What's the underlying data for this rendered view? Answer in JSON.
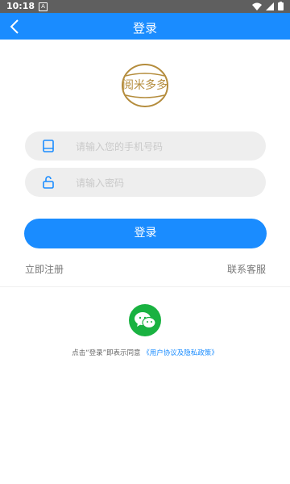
{
  "status": {
    "time": "10:18",
    "app_icon": "A"
  },
  "header": {
    "title": "登录"
  },
  "logo": {
    "text": "阅米多多"
  },
  "form": {
    "phone_placeholder": "请输入您的手机号码",
    "password_placeholder": "请输入密码",
    "login_label": "登录"
  },
  "links": {
    "register": "立即注册",
    "contact": "联系客服"
  },
  "agreement": {
    "prefix": "点击“登录”即表示同意",
    "policy": "《用户协议及隐私政策》"
  },
  "colors": {
    "primary": "#1a8cff",
    "wechat": "#19b241"
  }
}
